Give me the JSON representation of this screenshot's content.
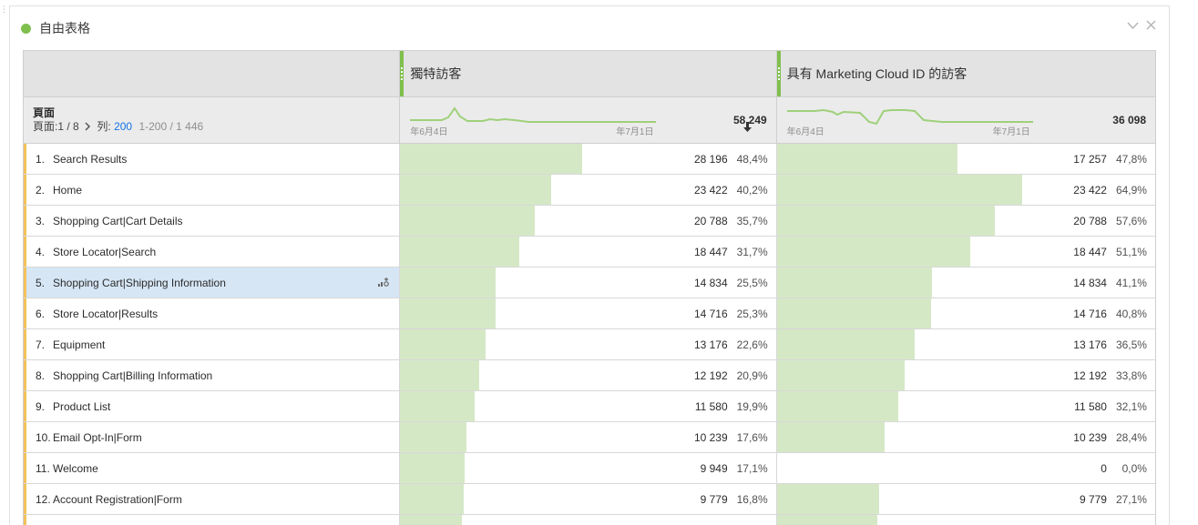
{
  "panel": {
    "title": "自由表格",
    "status_color": "#7fbf4d",
    "controls": [
      "chevron-down-icon",
      "close-icon"
    ]
  },
  "columns": {
    "metric1": "獨特訪客",
    "metric2": "具有 Marketing Cloud ID 的訪客"
  },
  "dimension": {
    "name": "頁面",
    "page_info": "頁面:1 / 8",
    "rows_label": "列:",
    "rows_value": "200",
    "range": "1-200 / 1 446"
  },
  "summary": {
    "metric1": {
      "total": "58 249",
      "sort": "descending",
      "date_start": "年6月4日",
      "date_end": "年7月1日"
    },
    "metric2": {
      "total": "36 098",
      "date_start": "年6月4日",
      "date_end": "年7月1日"
    }
  },
  "rows": [
    {
      "num": "1.",
      "label": "Search Results",
      "m1": "28 196",
      "m1_pct": "48,4%",
      "m1_frac": 0.484,
      "m2": "17 257",
      "m2_pct": "47,8%",
      "m2_frac": 0.478
    },
    {
      "num": "2.",
      "label": "Home",
      "m1": "23 422",
      "m1_pct": "40,2%",
      "m1_frac": 0.402,
      "m2": "23 422",
      "m2_pct": "64,9%",
      "m2_frac": 0.649
    },
    {
      "num": "3.",
      "label": "Shopping Cart|Cart Details",
      "m1": "20 788",
      "m1_pct": "35,7%",
      "m1_frac": 0.357,
      "m2": "20 788",
      "m2_pct": "57,6%",
      "m2_frac": 0.576
    },
    {
      "num": "4.",
      "label": "Store Locator|Search",
      "m1": "18 447",
      "m1_pct": "31,7%",
      "m1_frac": 0.317,
      "m2": "18 447",
      "m2_pct": "51,1%",
      "m2_frac": 0.511
    },
    {
      "num": "5.",
      "label": "Shopping Cart|Shipping Information",
      "m1": "14 834",
      "m1_pct": "25,5%",
      "m1_frac": 0.255,
      "m2": "14 834",
      "m2_pct": "41,1%",
      "m2_frac": 0.411,
      "selected": true
    },
    {
      "num": "6.",
      "label": "Store Locator|Results",
      "m1": "14 716",
      "m1_pct": "25,3%",
      "m1_frac": 0.253,
      "m2": "14 716",
      "m2_pct": "40,8%",
      "m2_frac": 0.408
    },
    {
      "num": "7.",
      "label": "Equipment",
      "m1": "13 176",
      "m1_pct": "22,6%",
      "m1_frac": 0.226,
      "m2": "13 176",
      "m2_pct": "36,5%",
      "m2_frac": 0.365
    },
    {
      "num": "8.",
      "label": "Shopping Cart|Billing Information",
      "m1": "12 192",
      "m1_pct": "20,9%",
      "m1_frac": 0.209,
      "m2": "12 192",
      "m2_pct": "33,8%",
      "m2_frac": 0.338
    },
    {
      "num": "9.",
      "label": "Product List",
      "m1": "11 580",
      "m1_pct": "19,9%",
      "m1_frac": 0.199,
      "m2": "11 580",
      "m2_pct": "32,1%",
      "m2_frac": 0.321
    },
    {
      "num": "10.",
      "label": "Email Opt-In|Form",
      "m1": "10 239",
      "m1_pct": "17,6%",
      "m1_frac": 0.176,
      "m2": "10 239",
      "m2_pct": "28,4%",
      "m2_frac": 0.284
    },
    {
      "num": "11.",
      "label": "Welcome",
      "m1": "9 949",
      "m1_pct": "17,1%",
      "m1_frac": 0.171,
      "m2": "0",
      "m2_pct": "0,0%",
      "m2_frac": 0.0
    },
    {
      "num": "12.",
      "label": "Account Registration|Form",
      "m1": "9 779",
      "m1_pct": "16,8%",
      "m1_frac": 0.168,
      "m2": "9 779",
      "m2_pct": "27,1%",
      "m2_frac": 0.271
    },
    {
      "num": "",
      "label": "",
      "m1": "",
      "m1_pct": "",
      "m1_frac": 0.165,
      "m2": "",
      "m2_pct": "",
      "m2_frac": 0.265
    }
  ],
  "colors": {
    "bar": "#d5e8c6",
    "spark": "#9fd07a",
    "accent_green": "#7fbf4d",
    "row_marker": "#f4c15a",
    "selected_row": "#d6e6f5",
    "link": "#1473e6"
  }
}
